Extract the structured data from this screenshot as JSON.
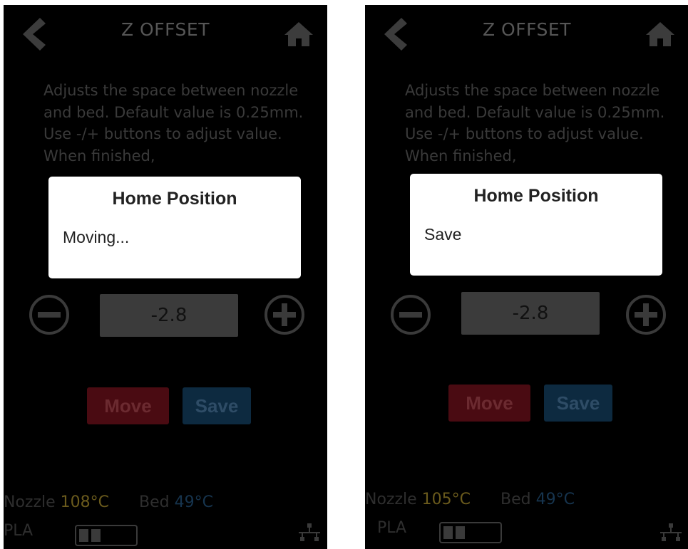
{
  "screens": [
    {
      "header": {
        "title": "Z OFFSET"
      },
      "description": "Adjusts the space between nozzle and bed. Default value is 0.25mm. Use -/+ buttons to adjust value. When finished,",
      "offset_value": "-2.8",
      "buttons": {
        "move": "Move",
        "save": "Save"
      },
      "status": {
        "nozzle_label": "Nozzle",
        "nozzle_temp": "108°C",
        "bed_label": "Bed",
        "bed_temp": "49°C",
        "filament": "PLA"
      },
      "dialog": {
        "title": "Home Position",
        "message": "Moving..."
      }
    },
    {
      "header": {
        "title": "Z OFFSET"
      },
      "description": "Adjusts the space between nozzle and bed. Default value is 0.25mm. Use -/+ buttons to adjust value. When finished,",
      "offset_value": "-2.8",
      "buttons": {
        "move": "Move",
        "save": "Save"
      },
      "status": {
        "nozzle_label": "Nozzle",
        "nozzle_temp": "105°C",
        "bed_label": "Bed",
        "bed_temp": "49°C",
        "filament": "PLA"
      },
      "dialog": {
        "title": "Home Position",
        "message": "Save"
      }
    }
  ],
  "colors": {
    "background": "#000000",
    "nozzle_temp": "#c9a84a",
    "bed_temp": "#2f6fa8",
    "move_button": "#8e1a26",
    "save_button": "#1e5a88",
    "dialog_bg": "#ffffff"
  }
}
